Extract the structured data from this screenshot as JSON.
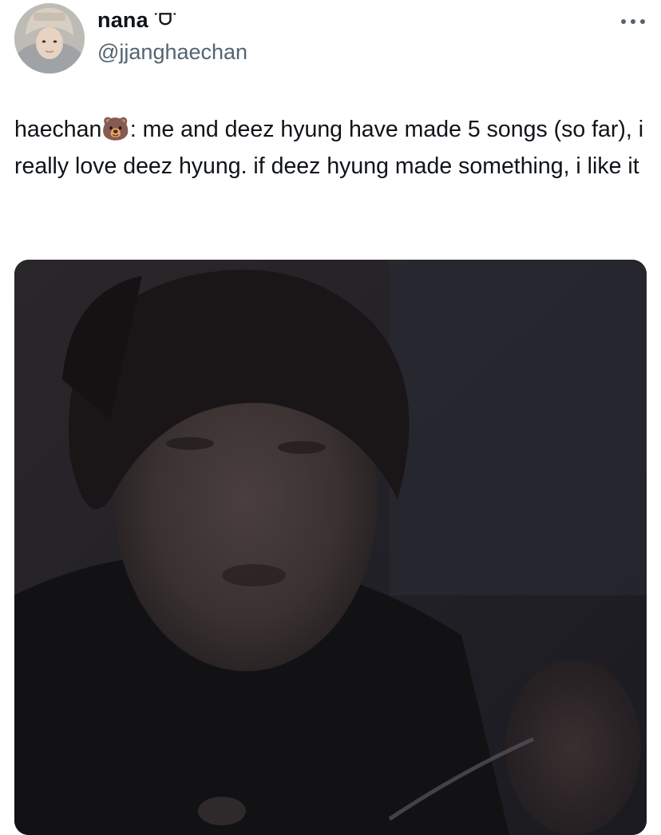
{
  "tweet": {
    "author": {
      "display_name": "nana",
      "name_emoji": "˙ᗜ˙",
      "handle": "@jjanghaechan"
    },
    "more_icon": "ellipsis-icon",
    "text": "haechan🐻: me and deez hyung have made 5 songs (so far), i really love deez hyung. if deez hyung made something, i like it",
    "media": {
      "type": "video-still"
    }
  }
}
